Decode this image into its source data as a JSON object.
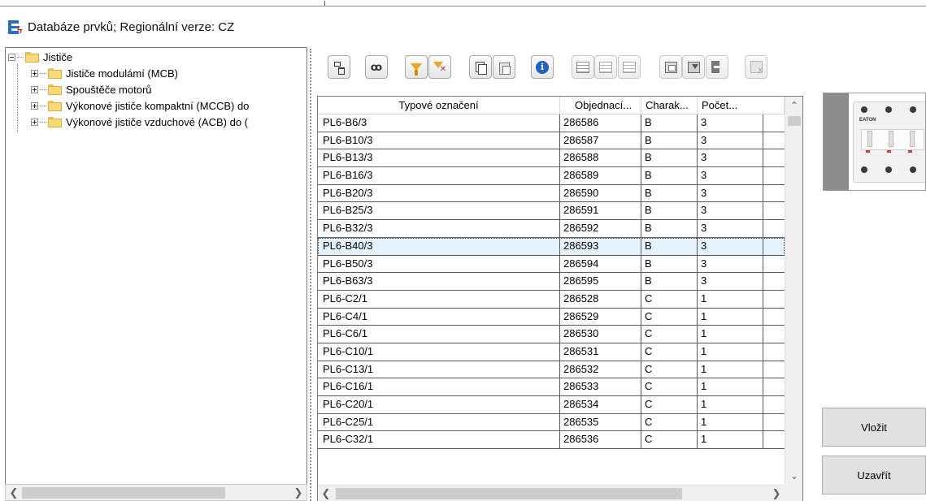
{
  "window": {
    "title": "Databáze prvků; Regionální verze: CZ",
    "icon": "eplan-app-icon"
  },
  "tree": {
    "root": "Jističe",
    "children": [
      "Jističe modulámí (MCB)",
      "Spouštěče motorů",
      "Výkonové jističe kompaktní (MCCB) do",
      "Výkonové jističe vzduchové (ACB) do ("
    ]
  },
  "toolbar": {
    "buttons": [
      {
        "icon": "tree-view-icon",
        "enabled": true
      },
      {
        "icon": "binoculars-icon",
        "enabled": true
      },
      {
        "icon": "filter-icon",
        "enabled": true
      },
      {
        "icon": "filter-remove-icon",
        "enabled": true
      },
      {
        "icon": "copy-icon",
        "enabled": true
      },
      {
        "icon": "paste-icon",
        "enabled": true
      },
      {
        "icon": "info-icon",
        "enabled": true
      },
      {
        "icon": "grid-icon",
        "enabled": false
      },
      {
        "icon": "grid-delete-icon",
        "enabled": false
      },
      {
        "icon": "grid-delete-2-icon",
        "enabled": false
      },
      {
        "icon": "image-icon",
        "enabled": false
      },
      {
        "icon": "image-down-icon",
        "enabled": false
      },
      {
        "icon": "eplan-icon",
        "enabled": false
      },
      {
        "icon": "delete-icon",
        "enabled": false
      }
    ]
  },
  "grid": {
    "columns": [
      "Typové označení",
      "Objednací...",
      "Charak...",
      "Počet..."
    ],
    "selected_row": 7,
    "rows": [
      [
        "PL6-B6/3",
        "286586",
        "B",
        "3"
      ],
      [
        "PL6-B10/3",
        "286587",
        "B",
        "3"
      ],
      [
        "PL6-B13/3",
        "286588",
        "B",
        "3"
      ],
      [
        "PL6-B16/3",
        "286589",
        "B",
        "3"
      ],
      [
        "PL6-B20/3",
        "286590",
        "B",
        "3"
      ],
      [
        "PL6-B25/3",
        "286591",
        "B",
        "3"
      ],
      [
        "PL6-B32/3",
        "286592",
        "B",
        "3"
      ],
      [
        "PL6-B40/3",
        "286593",
        "B",
        "3"
      ],
      [
        "PL6-B50/3",
        "286594",
        "B",
        "3"
      ],
      [
        "PL6-B63/3",
        "286595",
        "B",
        "3"
      ],
      [
        "PL6-C2/1",
        "286528",
        "C",
        "1"
      ],
      [
        "PL6-C4/1",
        "286529",
        "C",
        "1"
      ],
      [
        "PL6-C6/1",
        "286530",
        "C",
        "1"
      ],
      [
        "PL6-C10/1",
        "286531",
        "C",
        "1"
      ],
      [
        "PL6-C13/1",
        "286532",
        "C",
        "1"
      ],
      [
        "PL6-C16/1",
        "286533",
        "C",
        "1"
      ],
      [
        "PL6-C20/1",
        "286534",
        "C",
        "1"
      ],
      [
        "PL6-C25/1",
        "286535",
        "C",
        "1"
      ],
      [
        "PL6-C32/1",
        "286536",
        "C",
        "1"
      ]
    ]
  },
  "preview": {
    "label": "EATON"
  },
  "buttons": {
    "insert": "Vložit",
    "close": "Uzavřít"
  },
  "colors": {
    "selection": "#e6f2fb",
    "brand": "#2b6cc4",
    "accent": "#e21b1b"
  }
}
